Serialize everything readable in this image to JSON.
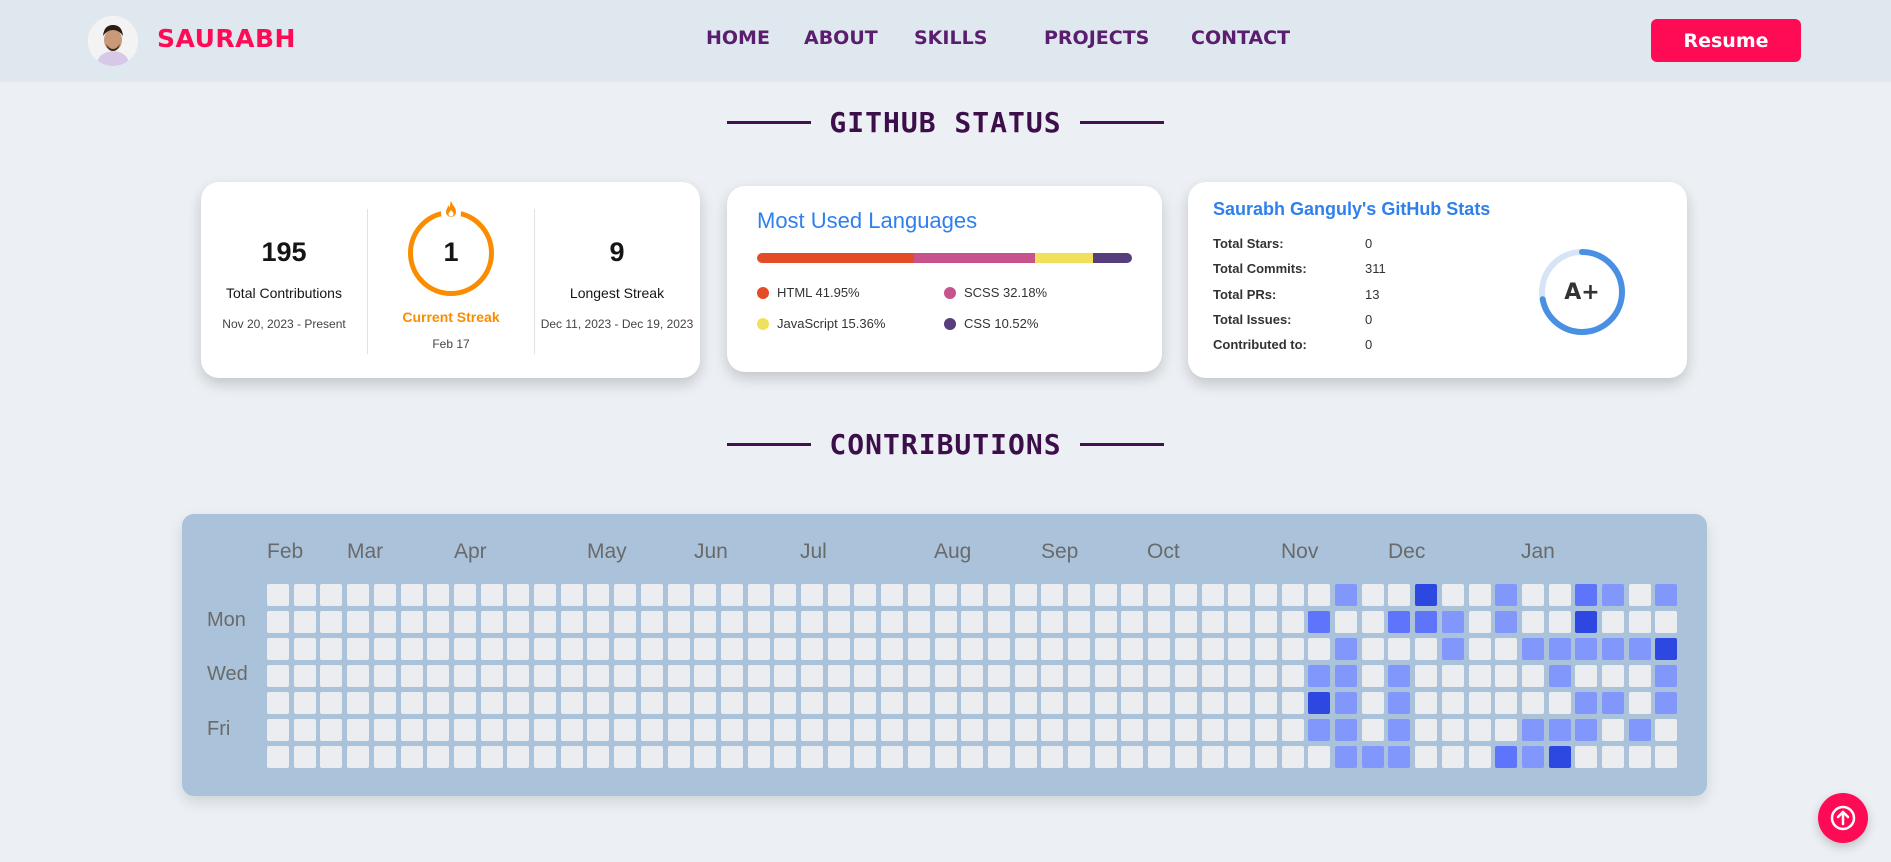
{
  "header": {
    "brand": "SAURABH",
    "nav": [
      "HOME",
      "ABOUT",
      "SKILLS",
      "PROJECTS",
      "CONTACT"
    ],
    "resume_label": "Resume"
  },
  "github_section": {
    "title": "GITHUB STATUS",
    "streak": {
      "total": "195",
      "total_label": "Total Contributions",
      "total_range": "Nov 20, 2023 - Present",
      "current": "1",
      "current_label": "Current Streak",
      "current_date": "Feb 17",
      "longest": "9",
      "longest_label": "Longest Streak",
      "longest_range": "Dec 11, 2023 - Dec 19, 2023"
    },
    "languages": {
      "title": "Most Used Languages",
      "items": [
        {
          "label": "HTML 41.95%",
          "percent": 41.95,
          "color": "#e34c26"
        },
        {
          "label": "SCSS 32.18%",
          "percent": 32.18,
          "color": "#c6538c"
        },
        {
          "label": "JavaScript 15.36%",
          "percent": 15.36,
          "color": "#f1e05a"
        },
        {
          "label": "CSS 10.52%",
          "percent": 10.52,
          "color": "#563d7c"
        }
      ]
    },
    "stats": {
      "title": "Saurabh Ganguly's GitHub Stats",
      "rows": [
        {
          "key": "Total Stars:",
          "value": "0"
        },
        {
          "key": "Total Commits:",
          "value": "311"
        },
        {
          "key": "Total PRs:",
          "value": "13"
        },
        {
          "key": "Total Issues:",
          "value": "0"
        },
        {
          "key": "Contributed to:",
          "value": "0"
        }
      ],
      "grade": "A+",
      "grade_progress": 0.72
    }
  },
  "contributions": {
    "title": "CONTRIBUTIONS",
    "months": [
      "Feb",
      "Mar",
      "Apr",
      "May",
      "Jun",
      "Jul",
      "Aug",
      "Sep",
      "Oct",
      "Nov",
      "Dec",
      "Jan"
    ],
    "days": [
      "Mon",
      "Wed",
      "Fri"
    ],
    "levels_colors": [
      "#ebedf0",
      "#8197fb",
      "#5d74fb",
      "#2d48e0"
    ],
    "active_weeks": [
      [
        0,
        2,
        0,
        1,
        3,
        1,
        0
      ],
      [
        1,
        0,
        1,
        1,
        1,
        1,
        1
      ],
      [
        0,
        0,
        0,
        0,
        0,
        0,
        1
      ],
      [
        0,
        2,
        0,
        1,
        1,
        1,
        1
      ],
      [
        3,
        2,
        0,
        0,
        0,
        0,
        0
      ],
      [
        0,
        1,
        1,
        0,
        0,
        0,
        0
      ],
      [
        0,
        0,
        0,
        0,
        0,
        0,
        0
      ],
      [
        1,
        1,
        0,
        0,
        0,
        0,
        2
      ],
      [
        0,
        0,
        1,
        0,
        0,
        1,
        1
      ],
      [
        0,
        0,
        1,
        1,
        0,
        1,
        3
      ],
      [
        2,
        3,
        1,
        0,
        1,
        1,
        0
      ],
      [
        1,
        0,
        1,
        0,
        1,
        0,
        0
      ],
      [
        0,
        0,
        1,
        0,
        0,
        1,
        0
      ],
      [
        1,
        0,
        3,
        1,
        1,
        0,
        0
      ]
    ]
  },
  "icons": {
    "avatar": "avatar-image",
    "fire": "fire-icon",
    "scroll_top": "arrow-up-icon"
  }
}
